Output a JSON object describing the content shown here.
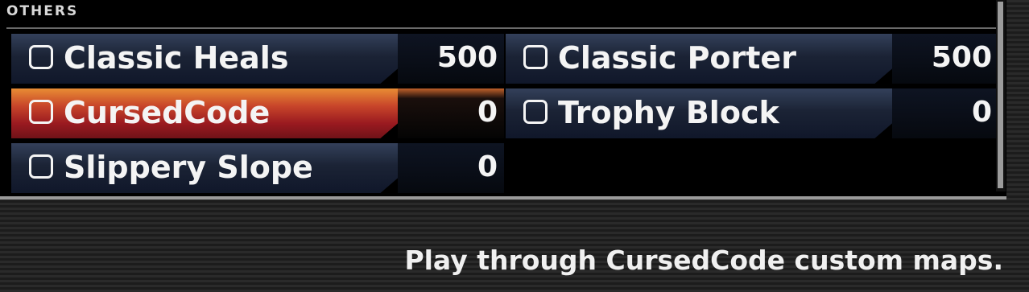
{
  "section": {
    "header": "OTHERS"
  },
  "items": [
    {
      "label": "Classic Heals",
      "value": "500",
      "selected": false
    },
    {
      "label": "Classic Porter",
      "value": "500",
      "selected": false
    },
    {
      "label": "CursedCode",
      "value": "0",
      "selected": true
    },
    {
      "label": "Trophy Block",
      "value": "0",
      "selected": false
    },
    {
      "label": "Slippery Slope",
      "value": "0",
      "selected": false
    }
  ],
  "description": "Play through CursedCode custom maps.",
  "colors": {
    "selected_top": "#e88c34",
    "selected_bottom": "#701218",
    "row_top": "#33405a",
    "row_bottom": "#10172a",
    "text": "#f4f4f4"
  }
}
